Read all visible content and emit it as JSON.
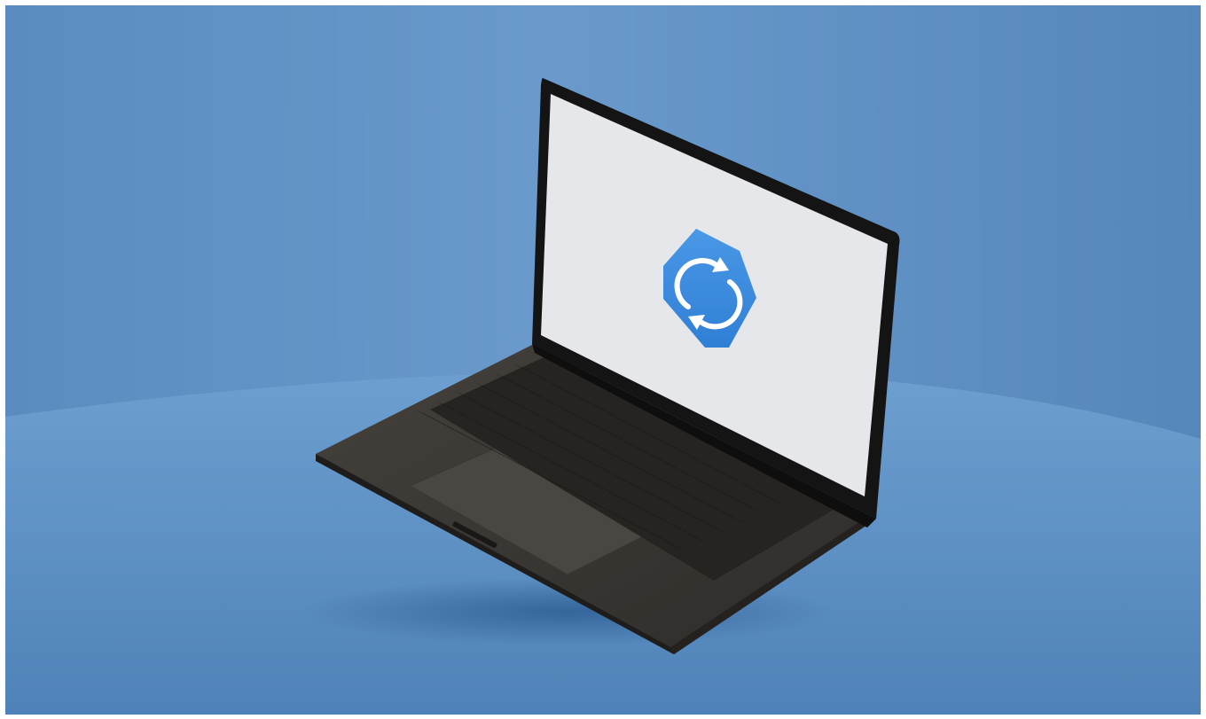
{
  "scene": {
    "subject": "laptop",
    "screen_icon": "sync-icon",
    "colors": {
      "backdrop": "#5d8fc2",
      "floor": "#5b8fc4",
      "laptop_body": "#3a3734",
      "screen": "#e4e6ea",
      "icon_blue": "#3f8fe0",
      "border": "#ffffff"
    }
  }
}
